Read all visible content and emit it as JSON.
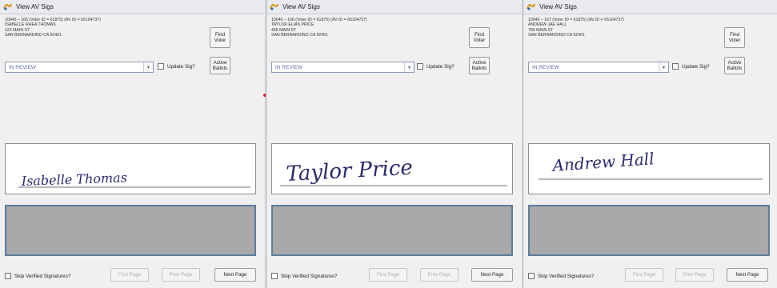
{
  "panels": [
    {
      "title": "View AV Sigs",
      "voter_line1": "10040 – 165 (Voter ID = 61875) (AV ID = 65104737)",
      "voter_name": "ISABELLE RHEA THOMAS",
      "voter_address": "123 MAIN ST",
      "voter_city": "SAN BERNARDINO CA 92401",
      "find_voter_label": "Find Voter",
      "status_value": "IN REVIEW",
      "update_sig_label": "Update Sig?",
      "active_ballots_label": "Active Ballots",
      "signature_text": "Isabelle Thomas",
      "skip_verified_label": "Skip Verified Signatures?",
      "first_page_label": "First Page",
      "prev_page_label": "Prev Page",
      "next_page_label": "Next Page"
    },
    {
      "title": "View AV Sigs",
      "voter_line1": "10040 – 166 (Voter ID = 61875) (AV ID = 65104737)",
      "voter_name": "TAYLOR ELIAS PRICE",
      "voter_address": "456 MAIN ST",
      "voter_city": "SAN BERNARDINO CA 92401",
      "find_voter_label": "Find Voter",
      "status_value": "IN REVIEW",
      "update_sig_label": "Update Sig?",
      "active_ballots_label": "Active Ballots",
      "signature_text": "Taylor Price",
      "skip_verified_label": "Skip Verified Signatures?",
      "first_page_label": "First Page",
      "prev_page_label": "Prev Page",
      "next_page_label": "Next Page"
    },
    {
      "title": "View AV Sigs",
      "voter_line1": "10040 – 167 (Voter ID = 61875) (AV ID = 65104737)",
      "voter_name": "ANDREW JAE HALL",
      "voter_address": "789 MAIN ST",
      "voter_city": "SAN BERNARDINO CA 92401",
      "find_voter_label": "Find Voter",
      "status_value": "IN REVIEW",
      "update_sig_label": "Update Sig?",
      "active_ballots_label": "Active Ballots",
      "signature_text": "Andrew Hall",
      "skip_verified_label": "Skip Verified Signatures?",
      "first_page_label": "First Page",
      "prev_page_label": "Prev Page",
      "next_page_label": "Next Page"
    }
  ],
  "icons": {
    "window_icon": "app-window-icon",
    "dropdown_icon": "chevron-down-icon"
  },
  "colors": {
    "ink": "#2a2a6a",
    "frame_blue": "#5e7d9a",
    "canvas_gray": "#a9a9a9"
  }
}
